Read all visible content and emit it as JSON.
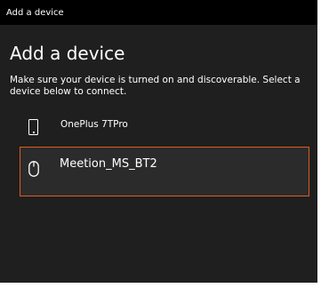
{
  "window": {
    "title": "Add a device"
  },
  "main": {
    "heading": "Add a device",
    "instructions": "Make sure your device is turned on and discoverable. Select a device below to connect."
  },
  "devices": [
    {
      "name": "OnePlus 7TPro",
      "icon": "phone-icon",
      "selected": false
    },
    {
      "name": "Meetion_MS_BT2",
      "icon": "mouse-icon",
      "selected": true
    }
  ],
  "colors": {
    "background": "#1f1f1f",
    "titlebar": "#000000",
    "selection_border": "#e05a1c",
    "selected_row": "#2b2b2b",
    "text": "#ffffff"
  }
}
